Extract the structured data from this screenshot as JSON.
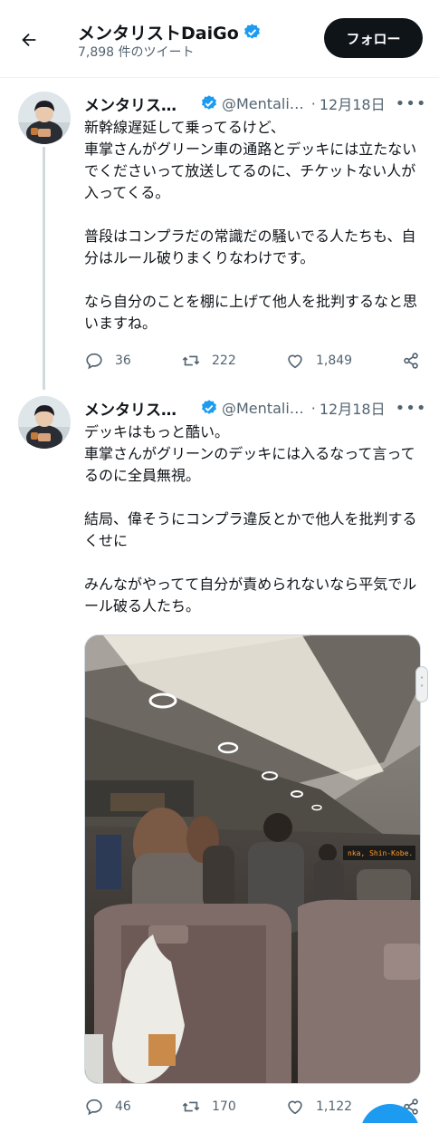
{
  "header": {
    "title": "メンタリストDaiGo",
    "subtitle": "7,898 件のツイート",
    "follow_label": "フォロー"
  },
  "tweets": [
    {
      "name": "メンタリス…",
      "handle": "@Mentali…",
      "date": "12月18日",
      "paragraphs": [
        "新幹線遅延して乗ってるけど、",
        "車掌さんがグリーン車の通路とデッキには立たないでくださいって放送してるのに、チケットない人が入ってくる。",
        "",
        "普段はコンプラだの常識だの騒いでる人たちも、自分はルール破りまくりなわけです。",
        "",
        "なら自分のことを棚に上げて他人を批判するなと思いますね。"
      ],
      "replies": "36",
      "retweets": "222",
      "likes": "1,849"
    },
    {
      "name": "メンタリス…",
      "handle": "@Mentali…",
      "date": "12月18日",
      "paragraphs": [
        "デッキはもっと酷い。",
        "車掌さんがグリーンのデッキには入るなって言ってるのに全員無視。",
        "",
        "結局、偉そうにコンプラ違反とかで他人を批判するくせに",
        "",
        "みんながやってて自分が責められないなら平気でルール破る人たち。"
      ],
      "replies": "46",
      "retweets": "170",
      "likes": "1,122"
    }
  ],
  "media": {
    "display_sign": "nka, Shin-Kobe."
  },
  "colors": {
    "accent": "#1d9bf0",
    "text": "#0f1419",
    "muted": "#536471"
  }
}
